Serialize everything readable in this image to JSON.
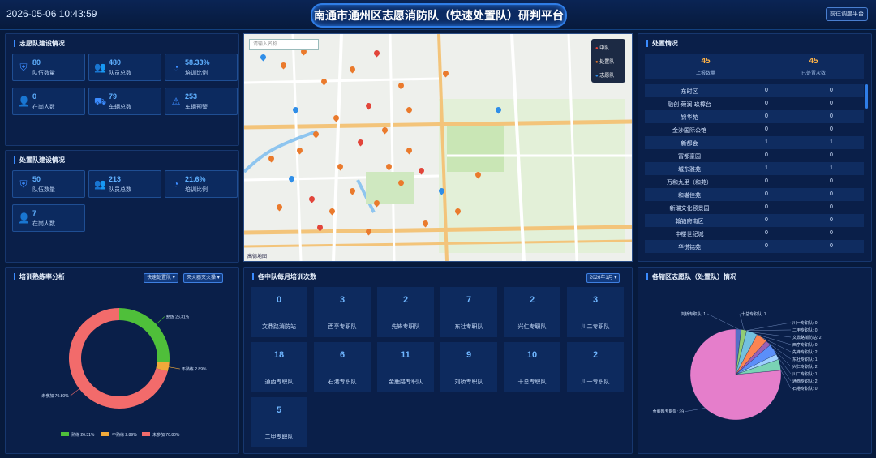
{
  "header": {
    "datetime": "2026-05-06 10:43:59",
    "title": "南通市通州区志愿消防队（快速处置队）研判平台",
    "right_button": "前往调度平台"
  },
  "volunteer": {
    "title": "志愿队建设情况",
    "stats": [
      {
        "icon": "shield-icon",
        "value": "80",
        "label": "队伍数量"
      },
      {
        "icon": "people-icon",
        "value": "480",
        "label": "队员总数"
      },
      {
        "icon": "pie-icon",
        "value": "58.33%",
        "label": "培训比例"
      },
      {
        "icon": "person-icon",
        "value": "0",
        "label": "在岗人数"
      },
      {
        "icon": "truck-icon",
        "value": "79",
        "label": "车辆总数"
      },
      {
        "icon": "warning-icon",
        "value": "253",
        "label": "车辆预警"
      }
    ]
  },
  "rapid": {
    "title": "处置队建设情况",
    "stats": [
      {
        "icon": "shield-icon",
        "value": "50",
        "label": "队伍数量"
      },
      {
        "icon": "people-icon",
        "value": "213",
        "label": "队员总数"
      },
      {
        "icon": "pie-icon",
        "value": "21.6%",
        "label": "培训比例"
      },
      {
        "icon": "person-icon",
        "value": "7",
        "label": "在岗人数"
      }
    ]
  },
  "map": {
    "search_placeholder": "请输入名称",
    "legend": [
      "中队",
      "处置队",
      "志愿队"
    ],
    "provider": "高德地图",
    "colors": {
      "station": "#e2453a",
      "rapid": "#ea7a2c",
      "volunteer": "#2f8ee8"
    }
  },
  "dispatch": {
    "title": "处置情况",
    "summary": [
      {
        "value": "45",
        "label": "上报数量"
      },
      {
        "value": "45",
        "label": "已处置次数"
      }
    ],
    "rows": [
      {
        "name": "东时区",
        "a": "0",
        "b": "0"
      },
      {
        "name": "融创·荣润·玖樟台",
        "a": "0",
        "b": "0"
      },
      {
        "name": "锦华苑",
        "a": "0",
        "b": "0"
      },
      {
        "name": "金沙国际公馆",
        "a": "0",
        "b": "0"
      },
      {
        "name": "新都会",
        "a": "1",
        "b": "1"
      },
      {
        "name": "富都豪园",
        "a": "0",
        "b": "0"
      },
      {
        "name": "城东雅苑",
        "a": "1",
        "b": "1"
      },
      {
        "name": "万和九里（和苑）",
        "a": "0",
        "b": "0"
      },
      {
        "name": "和樾佳苑",
        "a": "0",
        "b": "0"
      },
      {
        "name": "新瑞文化颐景园",
        "a": "0",
        "b": "0"
      },
      {
        "name": "翰铂府南区",
        "a": "0",
        "b": "0"
      },
      {
        "name": "中楼世纪城",
        "a": "0",
        "b": "0"
      },
      {
        "name": "华悦铭苑",
        "a": "0",
        "b": "0"
      }
    ]
  },
  "training": {
    "title": "培训熟练率分析",
    "selects": [
      "快速处置队",
      "灭火器灭火操"
    ],
    "chart_data": {
      "type": "pie",
      "title": "",
      "donut": true,
      "slices": [
        {
          "name": "熟练",
          "value": 26.31,
          "label": "熟练 26.31%",
          "color": "#4fbf3a"
        },
        {
          "name": "不熟练",
          "value": 2.89,
          "label": "不熟练 2.89%",
          "color": "#f0a93a"
        },
        {
          "name": "未参加",
          "value": 70.8,
          "label": "未参加 70.80%",
          "color": "#f26b6b"
        }
      ],
      "legend_position": "bottom"
    }
  },
  "monthly": {
    "title": "各中队每月培训次数",
    "month": "2026年1月",
    "cells": [
      {
        "count": "0",
        "name": "文鼎路消防站"
      },
      {
        "count": "3",
        "name": "西亭专职队"
      },
      {
        "count": "2",
        "name": "先锋专职队"
      },
      {
        "count": "7",
        "name": "东社专职队"
      },
      {
        "count": "2",
        "name": "兴仁专职队"
      },
      {
        "count": "3",
        "name": "川二专职队"
      },
      {
        "count": "18",
        "name": "通西专职队"
      },
      {
        "count": "6",
        "name": "石港专职队"
      },
      {
        "count": "11",
        "name": "金鹿路专职队"
      },
      {
        "count": "9",
        "name": "刘桥专职队"
      },
      {
        "count": "10",
        "name": "十总专职队"
      },
      {
        "count": "2",
        "name": "川一专职队"
      },
      {
        "count": "5",
        "name": "二甲专职队"
      }
    ]
  },
  "district": {
    "title": "各辖区志愿队（处置队）情况",
    "chart_data": {
      "type": "pie",
      "title": "",
      "slices": [
        {
          "name": "刘桥专职队",
          "value": 1,
          "label": "刘桥专职队: 1",
          "color": "#5470c6"
        },
        {
          "name": "十总专职队",
          "value": 1,
          "label": "十总专职队: 1",
          "color": "#91cc75"
        },
        {
          "name": "川一专职队",
          "value": 0,
          "label": "川一专职队: 0",
          "color": "#fac858"
        },
        {
          "name": "二甲专职队",
          "value": 0,
          "label": "二甲专职队: 0",
          "color": "#ee6666"
        },
        {
          "name": "文鼎路消防站",
          "value": 2,
          "label": "文鼎路消防站: 2",
          "color": "#73c0de"
        },
        {
          "name": "西亭专职队",
          "value": 0,
          "label": "西亭专职队: 0",
          "color": "#3ba272"
        },
        {
          "name": "先锋专职队",
          "value": 2,
          "label": "先锋专职队: 2",
          "color": "#fc8452"
        },
        {
          "name": "东社专职队",
          "value": 1,
          "label": "东社专职队: 1",
          "color": "#9a60b4"
        },
        {
          "name": "兴仁专职队",
          "value": 2,
          "label": "兴仁专职队: 2",
          "color": "#5b8ff9"
        },
        {
          "name": "川二专职队",
          "value": 1,
          "label": "川二专职队: 1",
          "color": "#a0d0ff"
        },
        {
          "name": "通西专职队",
          "value": 2,
          "label": "通西专职队: 2",
          "color": "#7ad3b5"
        },
        {
          "name": "石港专职队",
          "value": 0,
          "label": "石港专职队: 0",
          "color": "#ffb980"
        },
        {
          "name": "金鹿路专职队",
          "value": 39,
          "label": "金鹿路专职队: 39",
          "color": "#e57ecb"
        }
      ]
    }
  }
}
